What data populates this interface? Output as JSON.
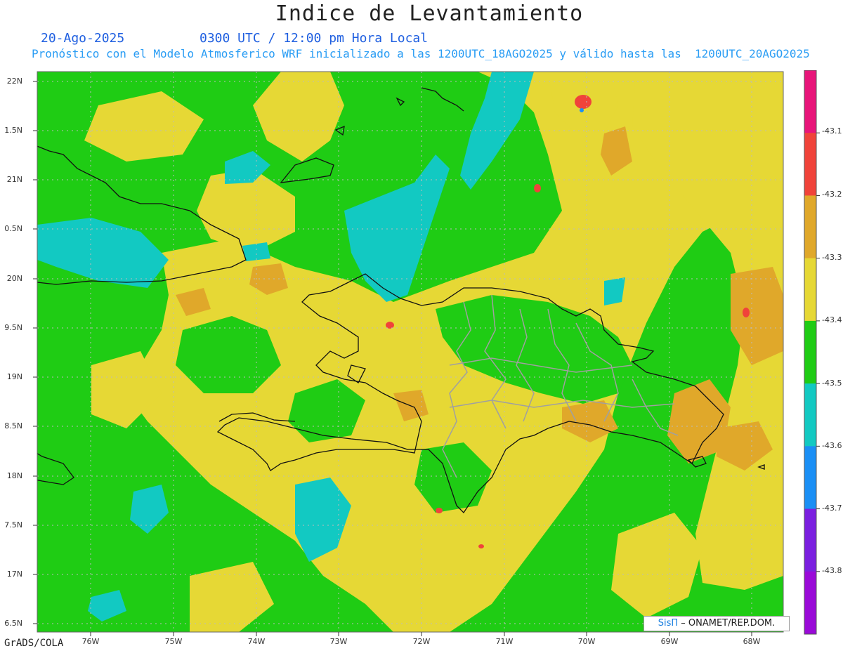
{
  "title": "Indice de Levantamiento",
  "date": "20-Ago-2025",
  "valid_time": "0300 UTC / 12:00 pm Hora Local",
  "forecast_info": "Pronóstico con el Modelo Atmosferico WRF inicializado a las 1200UTC_18AGO2025 y válido hasta las  1200UTC_20AGO2025",
  "lat_labels": [
    "22N",
    "1.5N",
    "21N",
    "0.5N",
    "20N",
    "9.5N",
    "19N",
    "8.5N",
    "18N",
    "7.5N",
    "17N",
    "6.5N"
  ],
  "lon_labels": [
    "76W",
    "75W",
    "74W",
    "73W",
    "72W",
    "71W",
    "70W",
    "69W",
    "68W"
  ],
  "colorbar": {
    "labels": [
      "-43.1",
      "-43.2",
      "-43.3",
      "-43.4",
      "-43.5",
      "-43.6",
      "-43.7",
      "-43.8"
    ],
    "colors": [
      "#e8157a",
      "#f0433a",
      "#e0a82a",
      "#e6d835",
      "#1fcc14",
      "#12c9c2",
      "#1a8ff5",
      "#7b1fe0",
      "#9a0ad8"
    ]
  },
  "map_colors": {
    "green": "#1fcc14",
    "yellow": "#e6d835",
    "orange": "#e0a82a",
    "cyan": "#12c9c2",
    "red": "#f0433a"
  },
  "credit": {
    "sis": "SisΠ",
    "org": " – ONAMET/REP.DOM."
  },
  "software": "GrADS/COLA"
}
